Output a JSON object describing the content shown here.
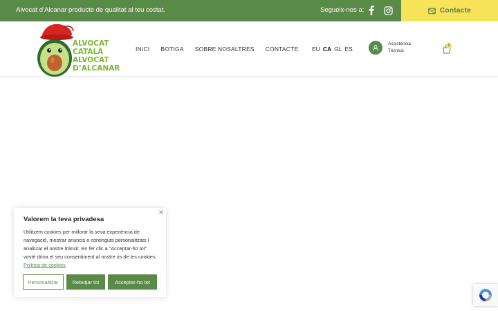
{
  "topbar": {
    "tagline": "Alvocat d’Alcanar producte de qualitat al teu costat.",
    "social_label": "Segueix-nos a:",
    "social_icons": [
      "facebook-icon",
      "instagram-icon"
    ],
    "contact_label": "Contacte",
    "contact_icon": "envelope-check-icon",
    "bg_color": "#5a8a47",
    "accent_color": "#f6e35a"
  },
  "header": {
    "logo_lines": [
      "ALVOCAT",
      "CATALÀ",
      "ALVOCAT",
      "D’ALCANAR"
    ],
    "logo_color": "#7bb834",
    "nav": [
      {
        "label": "INICI"
      },
      {
        "label": "BOTIGA"
      },
      {
        "label": "SOBRE NOSALTRES"
      },
      {
        "label": "CONTACTE"
      }
    ],
    "languages": [
      {
        "code": "EU",
        "active": false
      },
      {
        "code": "CA",
        "active": true
      },
      {
        "code": "GL",
        "active": false
      },
      {
        "code": "ES",
        "active": false
      }
    ],
    "support": {
      "line1": "Assistència",
      "line2": "Tècnica",
      "icon": "user-icon"
    },
    "cart": {
      "icon": "shopping-bag-icon",
      "count": "0"
    }
  },
  "cookie_banner": {
    "title": "Valorem la teva privadesa",
    "body": "Utilitzem cookies per millorar la seva experiència de navegació, mostrar anuncis o continguts personalitzats i analitzar el nostre trànsit. En fer clic a \"Acceptar-ho tot\" vostè dóna el seu consentiment al nostre ús de les cookies.",
    "policy_link": "Política de cookies",
    "buttons": {
      "customize": "Personalitzar",
      "reject": "Rebutjar tot",
      "accept": "Acceptar-ho tot"
    },
    "close_icon": "close-icon"
  },
  "recaptcha": {
    "icon": "recaptcha-icon"
  }
}
